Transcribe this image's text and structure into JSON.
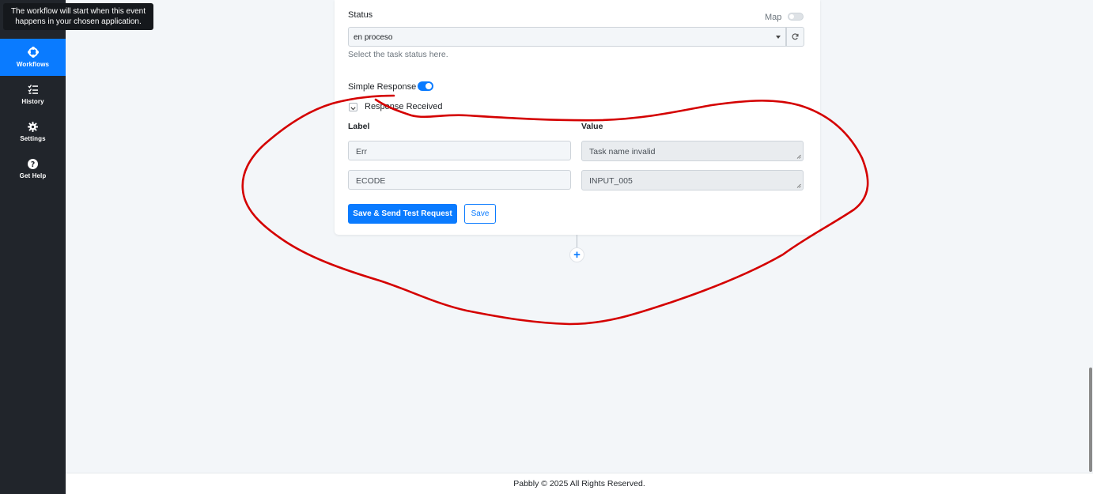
{
  "tooltip": {
    "line1": "The workflow will start when this event",
    "line2": "happens in your chosen application."
  },
  "sidebar": {
    "items": [
      {
        "label": "Workflows",
        "icon": "workflows-icon",
        "active": true
      },
      {
        "label": "History",
        "icon": "history-icon"
      },
      {
        "label": "Settings",
        "icon": "gear-icon"
      },
      {
        "label": "Get Help",
        "icon": "help-icon"
      }
    ]
  },
  "form": {
    "status_label": "Status",
    "map_label": "Map",
    "status_value": "en proceso",
    "status_helper": "Select the task status here.",
    "simple_response_label": "Simple Response",
    "response_received_label": "Response Received",
    "columns": {
      "label": "Label",
      "value": "Value"
    },
    "rows": [
      {
        "label": "Err",
        "value": "Task name invalid"
      },
      {
        "label": "ECODE",
        "value": "INPUT_005"
      }
    ],
    "save_send_button": "Save & Send Test Request",
    "save_button": "Save"
  },
  "add_step": "+",
  "footer": {
    "text": "Pabbly © 2025 All Rights Reserved."
  },
  "colors": {
    "accent": "#0a7bff",
    "sidebar": "#21252b",
    "annotation": "#d40000"
  }
}
